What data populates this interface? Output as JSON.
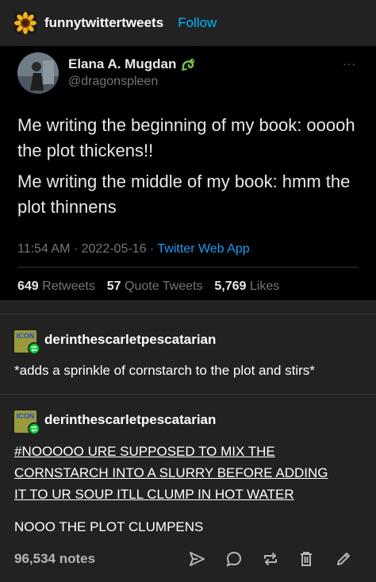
{
  "header": {
    "blog_name": "funnytwittertweets",
    "follow_label": "Follow",
    "avatar_icon": "sunflower-icon"
  },
  "tweet": {
    "author_name": "Elana A. Mugdan",
    "author_emoji": "dragon-icon",
    "author_handle": "@dragonspleen",
    "more_label": "···",
    "text_1": "Me writing the beginning of my book: ooooh the plot thickens!!",
    "text_2": "Me writing the middle of my book: hmm the plot thinnens",
    "time": "11:54 AM · 2022-05-16 · ",
    "source": "Twitter Web App",
    "retweets_count": "649",
    "retweets_label": "Retweets",
    "quotes_count": "57",
    "quotes_label": "Quote Tweets",
    "likes_count": "5,769",
    "likes_label": "Likes"
  },
  "reblogs": [
    {
      "username": "derinthescarletpescatarian",
      "avatar_text": "ICON",
      "text": "*adds a sprinkle of cornstarch to the plot and stirs*"
    },
    {
      "username": "derinthescarletpescatarian",
      "avatar_text": "ICON",
      "link_line_1": "#NOOOOO URE SUPPOSED TO MIX THE",
      "link_line_2": "CORNSTARCH INTO A SLURRY BEFORE ADDING",
      "link_line_3": "IT TO UR SOUP ITLL CLUMP IN HOT WATER",
      "text": "NOOO THE PLOT CLUMPENS"
    }
  ],
  "footer": {
    "notes": "96,534 notes",
    "actions": [
      "share-icon",
      "reply-icon",
      "reblog-icon",
      "delete-icon",
      "edit-icon"
    ]
  },
  "colors": {
    "background": "#222222",
    "tweet_background": "#000000",
    "accent_blue": "#00b8ff",
    "twitter_blue": "#1d9bf0",
    "reblog_green": "#00cf35"
  }
}
